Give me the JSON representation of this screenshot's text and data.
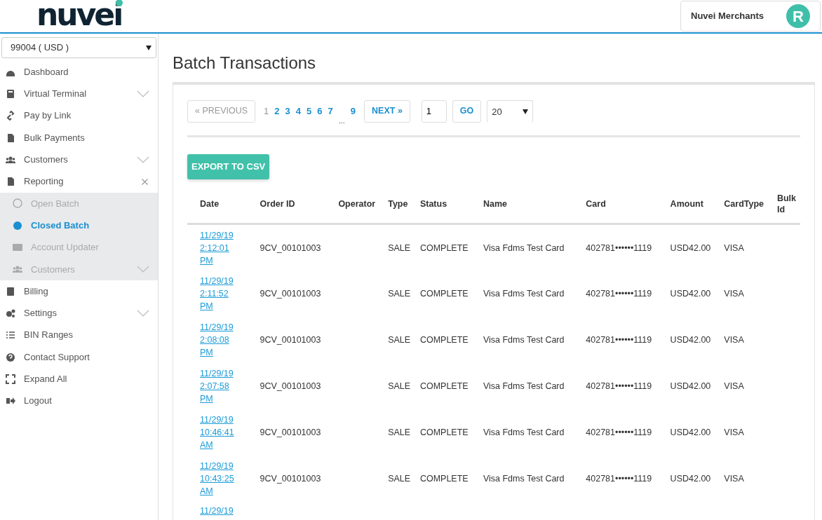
{
  "header": {
    "logo": "nuvei",
    "account": {
      "name": "Nuvei Merchants",
      "initial": "R"
    }
  },
  "sidebar": {
    "account_select": "99004 ( USD )",
    "items": [
      {
        "label": "Dashboard"
      },
      {
        "label": "Virtual Terminal",
        "expanded": false
      },
      {
        "label": "Pay by Link"
      },
      {
        "label": "Bulk Payments"
      },
      {
        "label": "Customers",
        "expanded": false
      },
      {
        "label": "Reporting",
        "expanded": true,
        "children": [
          {
            "label": "Open Batch",
            "selected": false
          },
          {
            "label": "Closed Batch",
            "selected": true
          },
          {
            "label": "Account Updater",
            "selected": false
          },
          {
            "label": "Customers",
            "selected": false,
            "expanded": false
          }
        ]
      },
      {
        "label": "Billing"
      },
      {
        "label": "Settings",
        "expanded": false
      },
      {
        "label": "BIN Ranges"
      },
      {
        "label": "Contact Support"
      },
      {
        "label": "Expand All"
      },
      {
        "label": "Logout"
      }
    ]
  },
  "page_title": "Batch Transactions",
  "pagination": {
    "previous": "« PREVIOUS",
    "pages": [
      {
        "label": "1",
        "selected": true
      },
      {
        "label": "2",
        "selected": false
      },
      {
        "label": "3",
        "selected": false
      },
      {
        "label": "4",
        "selected": false
      },
      {
        "label": "5",
        "selected": false
      },
      {
        "label": "6",
        "selected": false
      },
      {
        "label": "7",
        "selected": false
      },
      {
        "label": "...",
        "kind": "ellipsis"
      },
      {
        "label": "9",
        "selected": false
      }
    ],
    "next": "NEXT »",
    "page_input": "1",
    "go": "GO",
    "page_size": "20"
  },
  "export_button": "EXPORT TO CSV",
  "table": {
    "columns": [
      "Date",
      "Order ID",
      "Operator",
      "Type",
      "Status",
      "Name",
      "Card",
      "Amount",
      "CardType",
      "Bulk Id"
    ],
    "rows": [
      [
        "11/29/19 2:12:01 PM",
        "9CV_00101003",
        "",
        "SALE",
        "COMPLETE",
        "Visa Fdms Test Card",
        "402781••••••1119",
        "USD42.00",
        "VISA",
        ""
      ],
      [
        "11/29/19 2:11:52 PM",
        "9CV_00101003",
        "",
        "SALE",
        "COMPLETE",
        "Visa Fdms Test Card",
        "402781••••••1119",
        "USD42.00",
        "VISA",
        ""
      ],
      [
        "11/29/19 2:08:08 PM",
        "9CV_00101003",
        "",
        "SALE",
        "COMPLETE",
        "Visa Fdms Test Card",
        "402781••••••1119",
        "USD42.00",
        "VISA",
        ""
      ],
      [
        "11/29/19 2:07:58 PM",
        "9CV_00101003",
        "",
        "SALE",
        "COMPLETE",
        "Visa Fdms Test Card",
        "402781••••••1119",
        "USD42.00",
        "VISA",
        ""
      ],
      [
        "11/29/19 10:46:41 AM",
        "9CV_00101003",
        "",
        "SALE",
        "COMPLETE",
        "Visa Fdms Test Card",
        "402781••••••1119",
        "USD42.00",
        "VISA",
        ""
      ],
      [
        "11/29/19 10:43:25 AM",
        "9CV_00101003",
        "",
        "SALE",
        "COMPLETE",
        "Visa Fdms Test Card",
        "402781••••••1119",
        "USD42.00",
        "VISA",
        ""
      ],
      [
        "11/29/19",
        "",
        "",
        "",
        "",
        "",
        "",
        "",
        "",
        ""
      ]
    ]
  }
}
